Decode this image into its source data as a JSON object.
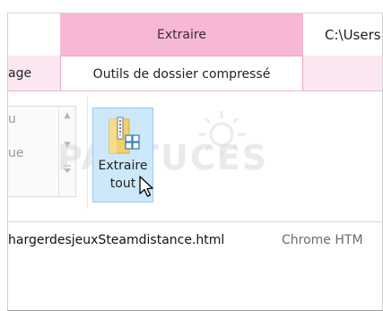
{
  "window": {
    "context_tab_header": "Extraire",
    "path_text": "C:\\Users",
    "left_tab_label": "age",
    "active_tab_label": "Outils de dossier compressé"
  },
  "ribbon": {
    "gallery_text_top": "u",
    "gallery_text_mid": "ue",
    "extract_button": {
      "line1": "Extraire",
      "line2": "tout"
    },
    "watermark": "PASTUCES"
  },
  "files": [
    {
      "name": "hargerdesjeuxSteamdistance.html",
      "type": "Chrome HTM"
    }
  ],
  "colors": {
    "context_header": "#f7b8d6",
    "tab_strip": "#fbe7f1",
    "button_hover": "#cde8fb",
    "button_border": "#96c8ef"
  },
  "icons": [
    "zip-folder-icon",
    "cursor-icon",
    "scroll-up-icon",
    "scroll-down-icon",
    "gallery-expand-icon"
  ]
}
